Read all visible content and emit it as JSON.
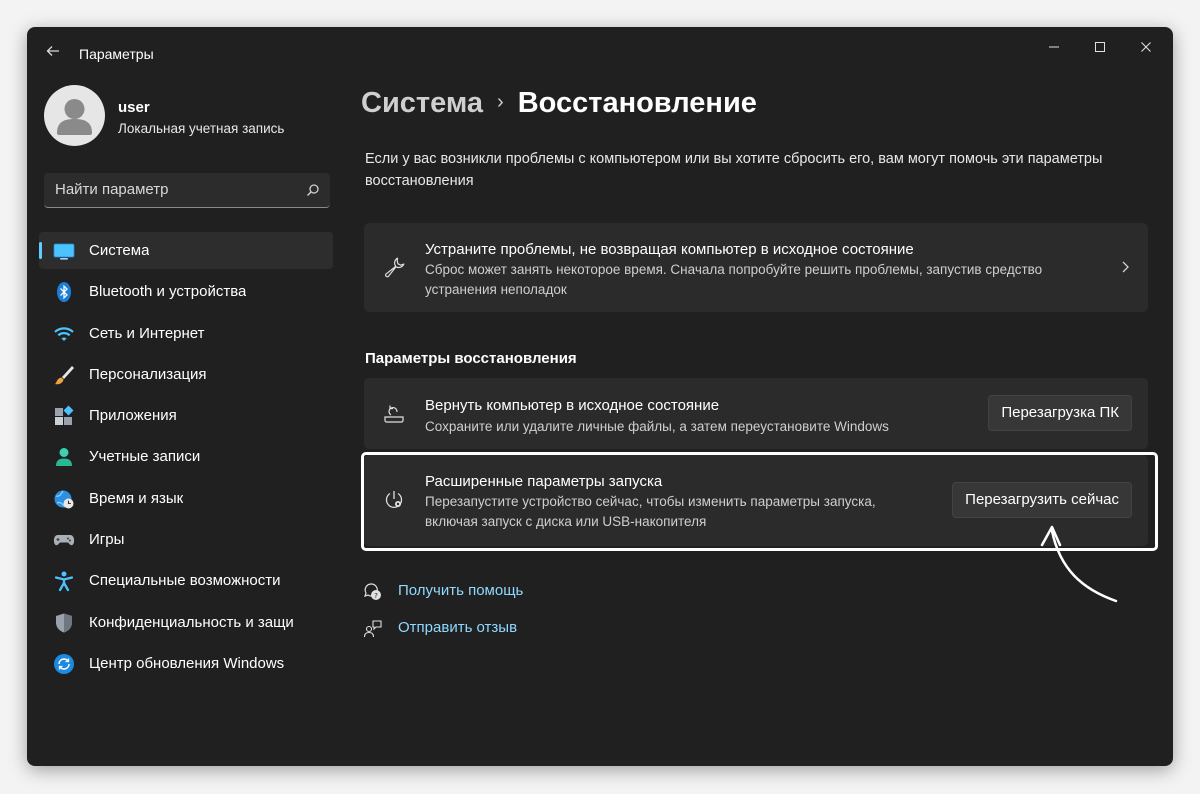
{
  "window": {
    "title": "Параметры",
    "controls": {
      "minimize": "minimize-icon",
      "maximize": "maximize-icon",
      "close": "close-icon"
    }
  },
  "profile": {
    "name": "user",
    "account_type": "Локальная учетная запись"
  },
  "search": {
    "placeholder": "Найти параметр",
    "icon": "search-icon"
  },
  "sidebar": {
    "accent": "#60cdff",
    "items": [
      {
        "label": "Система",
        "icon": "system-monitor-icon",
        "active": true
      },
      {
        "label": "Bluetooth и устройства",
        "icon": "bluetooth-icon"
      },
      {
        "label": "Сеть и Интернет",
        "icon": "wifi-icon"
      },
      {
        "label": "Персонализация",
        "icon": "brush-icon"
      },
      {
        "label": "Приложения",
        "icon": "apps-icon"
      },
      {
        "label": "Учетные записи",
        "icon": "account-icon"
      },
      {
        "label": "Время и язык",
        "icon": "globe-clock-icon"
      },
      {
        "label": "Игры",
        "icon": "gamepad-icon"
      },
      {
        "label": "Специальные возможности",
        "icon": "accessibility-icon"
      },
      {
        "label": "Конфиденциальность и защи",
        "icon": "shield-icon"
      },
      {
        "label": "Центр обновления Windows",
        "icon": "windows-update-icon"
      }
    ]
  },
  "main": {
    "breadcrumb": {
      "parent": "Система",
      "separator": "›",
      "current": "Восстановление"
    },
    "intro": "Если у вас возникли проблемы с компьютером или вы хотите сбросить его, вам могут помочь эти параметры восстановления",
    "troubleshoot_card": {
      "title": "Устраните проблемы, не возвращая компьютер в исходное состояние",
      "description": "Сброс может занять некоторое время. Сначала попробуйте решить проблемы, запустив средство устранения неполадок",
      "icon": "wrench-icon"
    },
    "recovery_section": {
      "title": "Параметры восстановления",
      "reset": {
        "title": "Вернуть компьютер в исходное состояние",
        "description": "Сохраните или удалите личные файлы, а затем переустановите Windows",
        "button": "Перезагрузка ПК",
        "icon": "reset-pc-icon"
      },
      "advanced_startup": {
        "title": "Расширенные параметры запуска",
        "description": "Перезапустите устройство сейчас, чтобы изменить параметры запуска, включая запуск с диска или USB-накопителя",
        "button": "Перезагрузить сейчас",
        "icon": "advanced-startup-icon"
      }
    },
    "links": {
      "help": "Получить помощь",
      "feedback": "Отправить отзыв"
    }
  },
  "colors": {
    "window_bg": "#202020",
    "card_bg": "#2b2b2b",
    "link": "#8fd8ff"
  }
}
